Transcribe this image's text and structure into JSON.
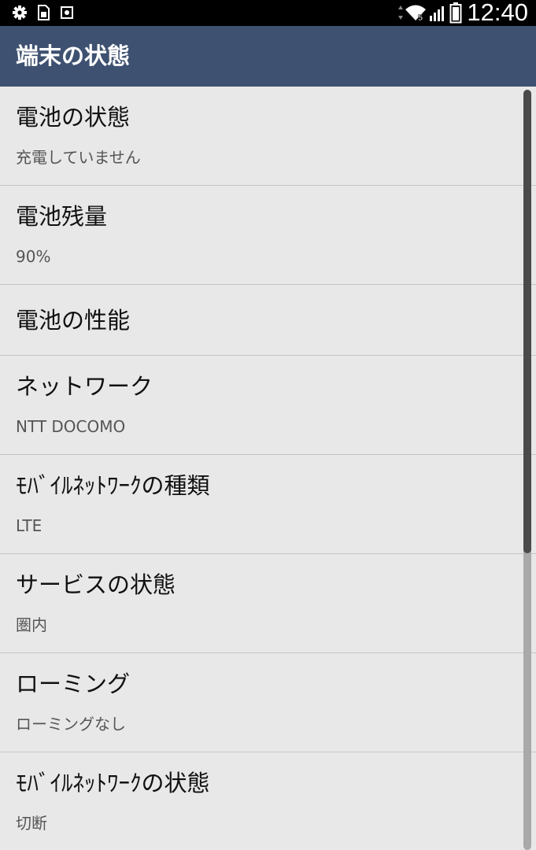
{
  "status_bar": {
    "left_icons": [
      "gear-icon",
      "sim-card-icon",
      "screenshot-icon"
    ],
    "network_badge": "5",
    "clock": "12:40"
  },
  "action_bar": {
    "title": "端末の状態",
    "background": "#3e5171"
  },
  "items": [
    {
      "title": "電池の状態",
      "summary": "充電していません"
    },
    {
      "title": "電池残量",
      "summary": "90%"
    },
    {
      "title": "電池の性能",
      "summary": ""
    },
    {
      "title": "ネットワーク",
      "summary": "NTT DOCOMO"
    },
    {
      "title": "ﾓﾊﾞｲﾙﾈｯﾄﾜｰｸの種類",
      "summary": "LTE"
    },
    {
      "title": "サービスの状態",
      "summary": "圏内"
    },
    {
      "title": "ローミング",
      "summary": "ローミングなし"
    },
    {
      "title": "ﾓﾊﾞｲﾙﾈｯﾄﾜｰｸの状態",
      "summary": "切断"
    }
  ],
  "scroll": {
    "position_fraction": 0.0,
    "visible_fraction": 0.61
  }
}
